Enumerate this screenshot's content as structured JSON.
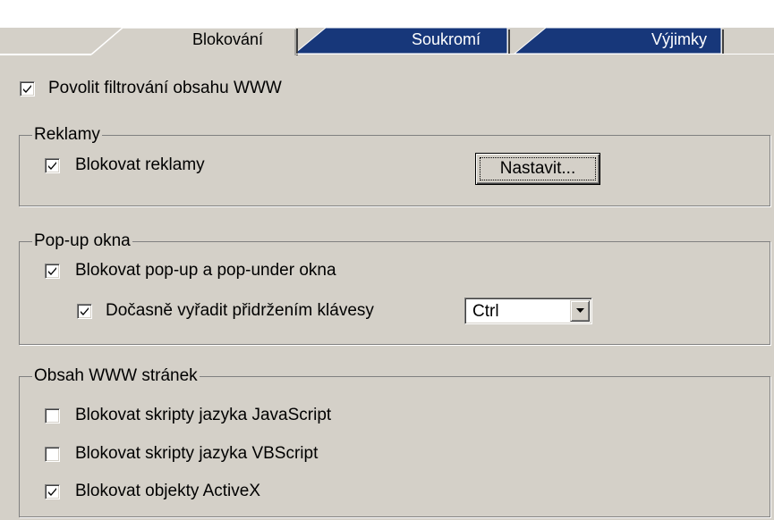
{
  "tabs": [
    {
      "label": "Blokování",
      "active": true
    },
    {
      "label": "Soukromí",
      "active": false
    },
    {
      "label": "Výjimky",
      "active": false
    }
  ],
  "colors": {
    "dialog_bg": "#d4d0c8",
    "inactive_tab": "#17377a"
  },
  "main": {
    "enable_filter": {
      "label": "Povolit filtrování obsahu WWW",
      "checked": true
    }
  },
  "ads": {
    "legend": "Reklamy",
    "block_ads": {
      "label": "Blokovat reklamy",
      "checked": true
    },
    "settings_button": "Nastavit..."
  },
  "popups": {
    "legend": "Pop-up okna",
    "block_popups": {
      "label": "Blokovat pop-up a pop-under okna",
      "checked": true
    },
    "temp_disable": {
      "label": "Dočasně vyřadit přidržením klávesy",
      "checked": true
    },
    "key_select": {
      "value": "Ctrl"
    }
  },
  "web_content": {
    "legend": "Obsah WWW stránek",
    "block_js": {
      "label": "Blokovat skripty jazyka JavaScript",
      "checked": false
    },
    "block_vbs": {
      "label": "Blokovat skripty jazyka VBScript",
      "checked": false
    },
    "block_activex": {
      "label": "Blokovat objekty ActiveX",
      "checked": true
    }
  }
}
